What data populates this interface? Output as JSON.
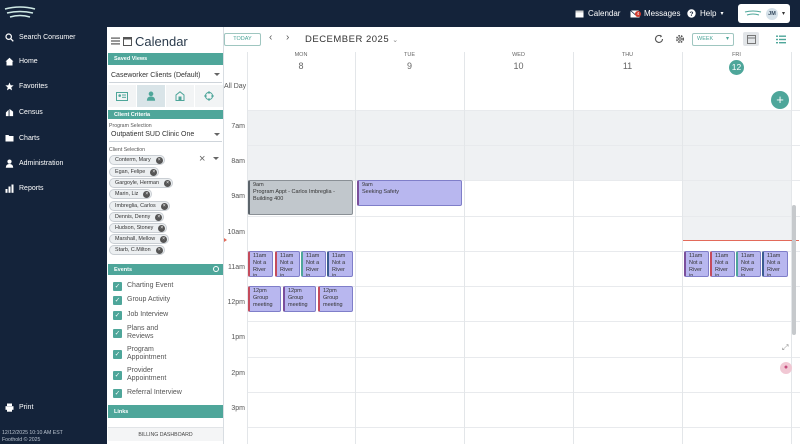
{
  "topbar": {
    "calendar": "Calendar",
    "messages": "Messages",
    "messages_badge": "4",
    "help": "Help",
    "user_initials": "JM"
  },
  "sidebar": {
    "items": [
      {
        "label": "Search Consumer",
        "icon": "search-icon"
      },
      {
        "label": "Home",
        "icon": "home-icon"
      },
      {
        "label": "Favorites",
        "icon": "star-icon"
      },
      {
        "label": "Census",
        "icon": "census-icon"
      },
      {
        "label": "Charts",
        "icon": "folder-icon"
      },
      {
        "label": "Administration",
        "icon": "person-icon"
      },
      {
        "label": "Reports",
        "icon": "chart-icon"
      },
      {
        "label": "Print",
        "icon": "print-icon"
      }
    ],
    "footer_time": "12/12/2025 10:10 AM EST",
    "footer_copy": "Foothold © 2025"
  },
  "panel": {
    "title": "Calendar",
    "saved_views_header": "Saved Views",
    "saved_view_value": "Caseworker Clients (Default)",
    "client_criteria_header": "Client Criteria",
    "program_label": "Program Selection",
    "program_value": "Outpatient SUD Clinic One",
    "client_label": "Client Selection",
    "clients": [
      "Conterm, Mary",
      "Egan, Felipe",
      "Gargoyle, Herman",
      "Marin, Liz",
      "Imbreglia, Carlos",
      "Dennis, Denny",
      "Hudson, Stoney",
      "Marshall, Mellow",
      "Starb, C.Milton"
    ],
    "events_header": "Events",
    "events": [
      "Charting Event",
      "Group Activity",
      "Job Interview",
      "Plans and Reviews",
      "Program Appointment",
      "Provider Appointment",
      "Referral Interview"
    ],
    "links_header": "Links",
    "billing_label": "BILLING DASHBOARD"
  },
  "calendar": {
    "today_btn": "TODAY",
    "prev": "‹",
    "next": "›",
    "title": "DECEMBER 2025",
    "view_btn": "WEEK",
    "all_day": "All Day",
    "days": [
      {
        "name": "MON",
        "date": "8"
      },
      {
        "name": "TUE",
        "date": "9"
      },
      {
        "name": "WED",
        "date": "10"
      },
      {
        "name": "THU",
        "date": "11"
      },
      {
        "name": "FRI",
        "date": "12"
      }
    ],
    "times": [
      "7am",
      "8am",
      "9am",
      "10am",
      "11am",
      "12pm",
      "1pm",
      "2pm",
      "3pm"
    ],
    "events": {
      "e1": {
        "time": "9am",
        "title": "Program Appt - Carlos Imbreglia - Building 400"
      },
      "e2": {
        "time": "9am",
        "title": "Seeking Safety"
      },
      "e_nr": {
        "time": "11am",
        "title": "Not a River in"
      },
      "e_gm": {
        "time": "12pm",
        "title": "Group meeting"
      }
    },
    "add_button": "+"
  },
  "colors": {
    "accent": "#4ea69a",
    "nav_bg": "#14233a",
    "event_gray": "#c1c7cc",
    "event_purple": "#b8b7ef"
  }
}
